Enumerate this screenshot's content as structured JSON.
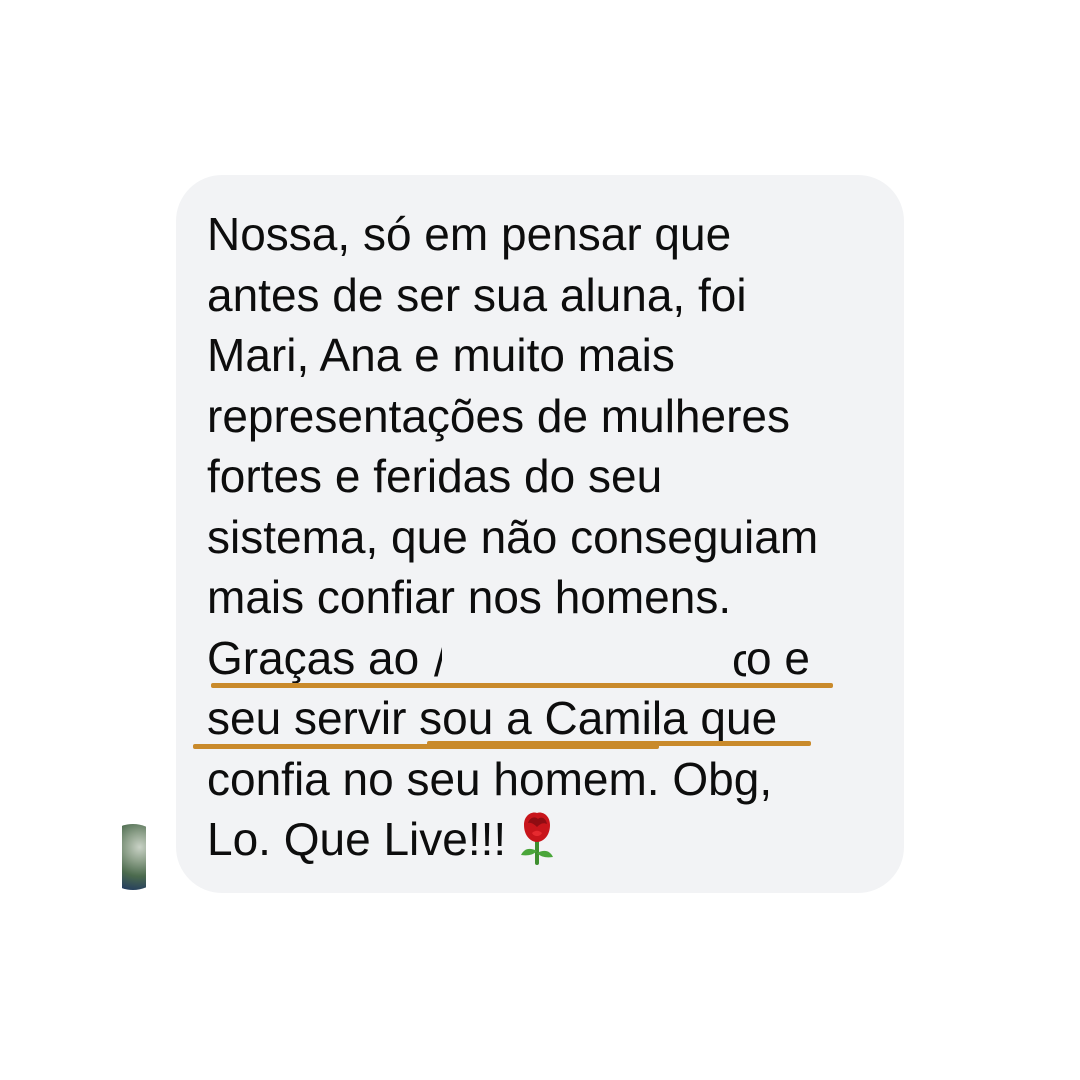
{
  "message": {
    "lines": [
      "Nossa, só em pensar que",
      "antes de ser sua aluna, foi",
      "Mari, Ana e muito mais",
      "representações de mulheres",
      "fortes e feridas do seu",
      "sistema, que não conseguiam",
      "mais confiar nos homens."
    ],
    "line8_start": "Graças ao ",
    "line8_end": "o e",
    "line9": "seu servir sou a Camila que",
    "line10": "confia no seu homem. Obg,",
    "line11": "Lo. Que Live!!!"
  },
  "icons": {
    "emoji": "rose-icon",
    "avatar": "avatar"
  },
  "colors": {
    "bubble": "#f2f3f5",
    "text": "#0d0d0d",
    "underline": "#c98a2b"
  }
}
